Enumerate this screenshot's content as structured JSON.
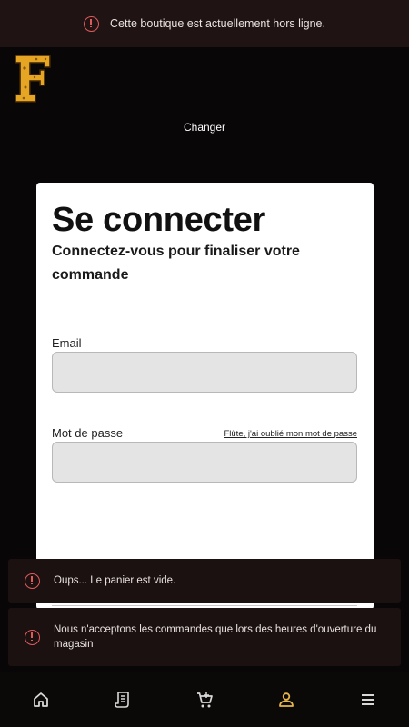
{
  "banner": {
    "message": "Cette boutique est actuellement hors ligne."
  },
  "header": {
    "change_label": "Changer"
  },
  "login": {
    "title": "Se connecter",
    "subtitle": "Connectez-vous pour finaliser votre commande",
    "email_label": "Email",
    "email_value": "",
    "password_label": "Mot de passe",
    "password_value": "",
    "forgot_link": "Flûte, j'ai oublié mon mot de passe"
  },
  "toasts": [
    {
      "message": "Oups... Le panier est vide."
    },
    {
      "message": "Nous n'acceptons les commandes que lors des heures d'ouverture du magasin"
    }
  ],
  "nav": {
    "items": [
      {
        "icon": "home-icon"
      },
      {
        "icon": "receipt-icon"
      },
      {
        "icon": "cart-icon"
      },
      {
        "icon": "account-icon",
        "active": true
      },
      {
        "icon": "menu-icon"
      }
    ],
    "active_color": "#e6b54a",
    "inactive_color": "#d8d8d8"
  },
  "colors": {
    "alert": "#e05a5a",
    "brand_logo": "#e6a623"
  }
}
